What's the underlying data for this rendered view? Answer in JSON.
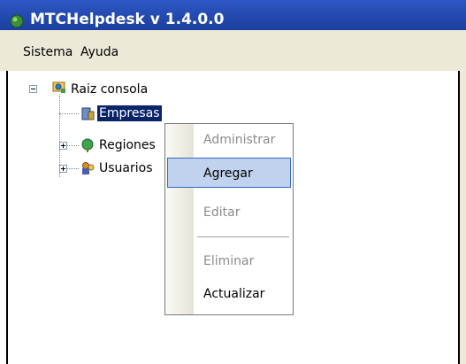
{
  "window": {
    "title": "MTCHelpdesk v 1.4.0.0",
    "icon": "app-icon"
  },
  "menubar": {
    "items": [
      {
        "label": "Sistema"
      },
      {
        "label": "Ayuda"
      }
    ]
  },
  "tree": {
    "root": {
      "label": "Raiz consola",
      "icon": "console-root-icon",
      "expanded": true
    },
    "children": [
      {
        "label": "Empresas",
        "icon": "company-icon",
        "selected": true,
        "has_children": false
      },
      {
        "label": "Regiones",
        "icon": "region-globe-icon",
        "selected": false,
        "has_children": true
      },
      {
        "label": "Usuarios",
        "icon": "users-icon",
        "selected": false,
        "has_children": true
      }
    ]
  },
  "context_menu": {
    "items": [
      {
        "label": "Administrar",
        "enabled": false
      },
      {
        "label": "Agregar",
        "enabled": true,
        "highlighted": true
      },
      {
        "label": "Editar",
        "enabled": false
      },
      {
        "label": "Eliminar",
        "enabled": false
      },
      {
        "label": "Actualizar",
        "enabled": true
      }
    ]
  },
  "colors": {
    "selection": "#0a246a",
    "menu_highlight": "#c1d2ee",
    "menu_highlight_border": "#316ac5",
    "titlebar": "#2d57c4",
    "chrome": "#ece9d8"
  }
}
